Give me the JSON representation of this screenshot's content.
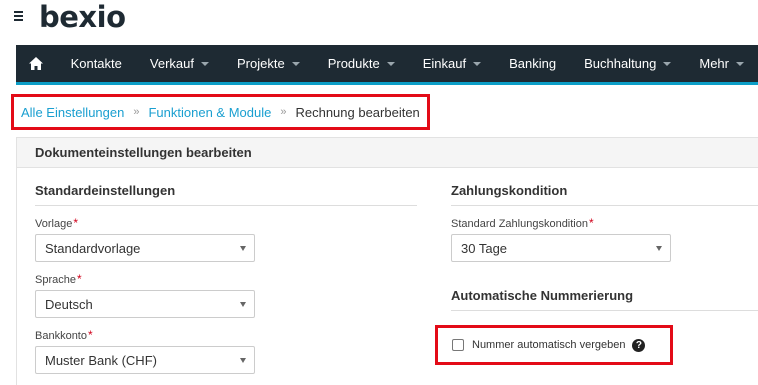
{
  "header": {
    "logo": "bexio",
    "menu_icon": "hamburger-icon"
  },
  "nav": {
    "home_icon": "home-icon",
    "items": [
      {
        "label": "Kontakte",
        "dropdown": false
      },
      {
        "label": "Verkauf",
        "dropdown": true
      },
      {
        "label": "Projekte",
        "dropdown": true
      },
      {
        "label": "Produkte",
        "dropdown": true
      },
      {
        "label": "Einkauf",
        "dropdown": true
      },
      {
        "label": "Banking",
        "dropdown": false
      },
      {
        "label": "Buchhaltung",
        "dropdown": true
      },
      {
        "label": "Mehr",
        "dropdown": true
      }
    ]
  },
  "breadcrumb": {
    "items": [
      "Alle Einstellungen",
      "Funktionen & Module"
    ],
    "separator": "»",
    "current": "Rechnung bearbeiten"
  },
  "panel": {
    "title": "Dokumenteinstellungen bearbeiten",
    "left": {
      "section_title": "Standardeinstellungen",
      "fields": [
        {
          "label": "Vorlage",
          "required": "*",
          "value": "Standardvorlage"
        },
        {
          "label": "Sprache",
          "required": "*",
          "value": "Deutsch"
        },
        {
          "label": "Bankkonto",
          "required": "*",
          "value": "Muster Bank (CHF)"
        }
      ]
    },
    "right": {
      "section_title": "Zahlungskondition",
      "field": {
        "label": "Standard Zahlungskondition",
        "required": "*",
        "value": "30 Tage"
      },
      "numbering_title": "Automatische Nummerierung",
      "checkbox_label": "Nummer automatisch vergeben",
      "checkbox_checked": false,
      "help_glyph": "?"
    }
  },
  "colors": {
    "nav_bg": "#1e2a33",
    "nav_accent": "#0c9ec7",
    "link": "#1a9fd0",
    "highlight": "#e30b17",
    "required": "#d0021b"
  }
}
